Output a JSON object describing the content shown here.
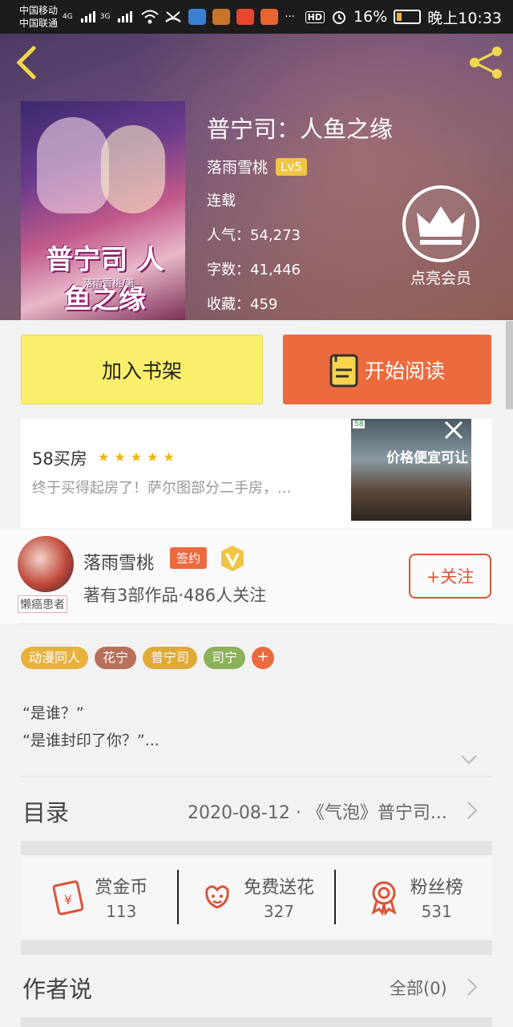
{
  "status_bar": {
    "carrier_1": "中国移动",
    "carrier_2": "中国联通",
    "net_1": "4G",
    "net_2": "3G",
    "more": "···",
    "hd": "HD",
    "battery": "16%",
    "time": "晚上10:33"
  },
  "book": {
    "title": "普宁司：人鱼之缘",
    "author": "落雨雪桃",
    "level": "Lv5",
    "status": "连载",
    "popularity": "人气：54,273",
    "word_count": "字数：41,446",
    "favorites": "收藏：459",
    "cover_title": "普宁司 人鱼之缘",
    "cover_author": "落雨雪桃/著",
    "vip_label": "点亮会员"
  },
  "actions": {
    "add_shelf": "加入书架",
    "start_reading": "开始阅读"
  },
  "ad": {
    "title": "58买房",
    "stars": "★★★★★",
    "description": "终于买得起房了！萨尔图部分二手房，...",
    "image_text": "价格便宜可让",
    "badge": "58"
  },
  "author_card": {
    "name": "落雨雪桃",
    "signed_badge": "签约",
    "avatar_tag": "懒癌患者",
    "works": "著有3部作品·486人关注",
    "follow": "+关注"
  },
  "tags": [
    {
      "label": "动漫同人",
      "color": "#e8b23c"
    },
    {
      "label": "花宁",
      "color": "#b8705a"
    },
    {
      "label": "普宁司",
      "color": "#e0aa36"
    },
    {
      "label": "司宁",
      "color": "#8cb05a"
    }
  ],
  "intro": {
    "line1": "“是谁？”",
    "line2": "“是谁封印了你？”..."
  },
  "catalog": {
    "title": "目录",
    "latest": "2020-08-12 · 《气泡》普宁司..."
  },
  "stats": [
    {
      "label": "赏金币",
      "value": "113",
      "icon": "red-envelope-icon"
    },
    {
      "label": "免费送花",
      "value": "327",
      "icon": "flower-icon"
    },
    {
      "label": "粉丝榜",
      "value": "531",
      "icon": "medal-icon"
    }
  ],
  "author_says": {
    "title": "作者说",
    "all": "全部(0)"
  },
  "colors": {
    "accent": "#eb6a3e",
    "shelf_button": "#f9ef6b",
    "icon_red": "#d9553a"
  }
}
